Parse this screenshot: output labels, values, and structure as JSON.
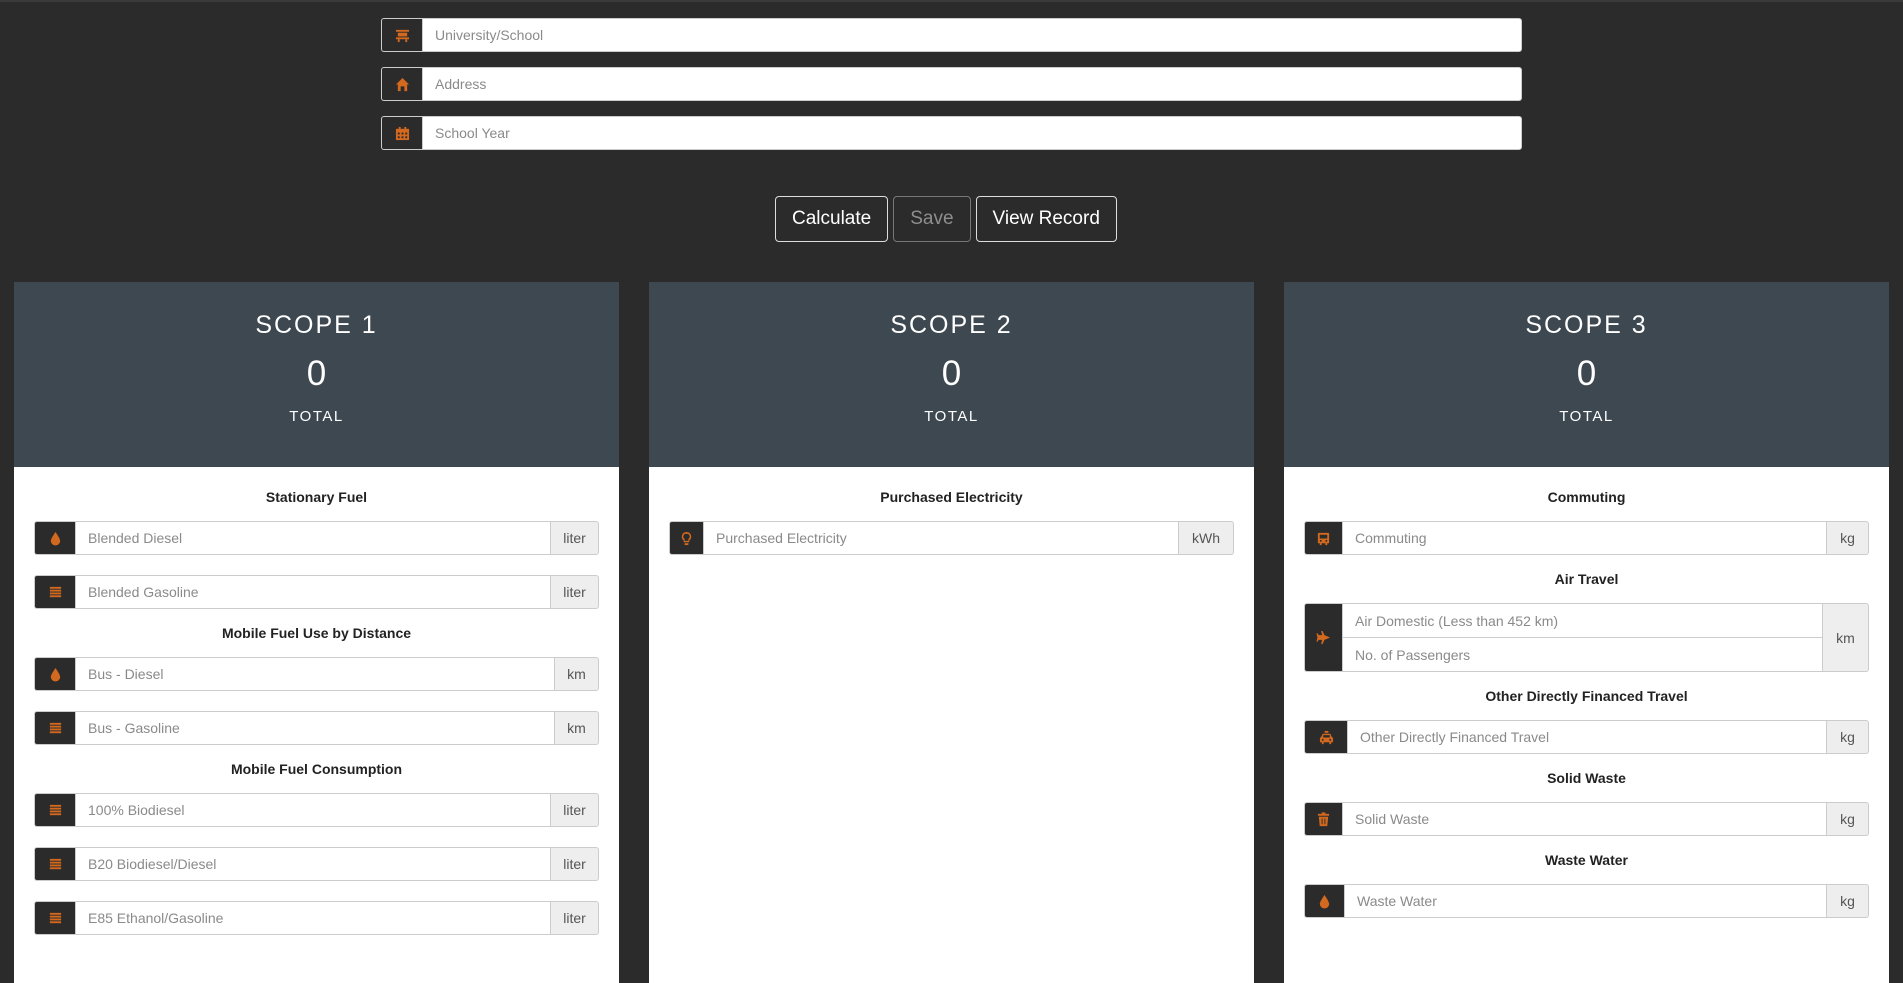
{
  "top_form": {
    "university_placeholder": "University/School",
    "address_placeholder": "Address",
    "school_year_placeholder": "School Year",
    "icons": [
      "school-icon",
      "home-icon",
      "calendar-icon"
    ]
  },
  "actions": {
    "calculate": "Calculate",
    "save": "Save",
    "view_record": "View Record"
  },
  "accent_color": "#d2691e",
  "scope1": {
    "title": "SCOPE 1",
    "total": "0",
    "total_label": "TOTAL",
    "stationary_title": "Stationary Fuel",
    "blended_diesel": "Blended Diesel",
    "blended_gasoline": "Blended Gasoline",
    "mobile_distance_title": "Mobile Fuel Use by Distance",
    "bus_diesel": "Bus - Diesel",
    "bus_gasoline": "Bus - Gasoline",
    "mobile_consumption_title": "Mobile Fuel Consumption",
    "biodiesel_100": "100% Biodiesel",
    "b20": "B20 Biodiesel/Diesel",
    "e85": "E85 Ethanol/Gasoline",
    "unit_liter": "liter",
    "unit_km": "km"
  },
  "scope2": {
    "title": "SCOPE 2",
    "total": "0",
    "total_label": "TOTAL",
    "electricity_title": "Purchased Electricity",
    "electricity_placeholder": "Purchased Electricity",
    "unit_kwh": "kWh"
  },
  "scope3": {
    "title": "SCOPE 3",
    "total": "0",
    "total_label": "TOTAL",
    "commuting_title": "Commuting",
    "commuting_placeholder": "Commuting",
    "air_title": "Air Travel",
    "air_domestic_placeholder": "Air Domestic (Less than 452 km)",
    "passengers_placeholder": "No. of Passengers",
    "other_travel_title": "Other Directly Financed Travel",
    "other_travel_placeholder": "Other Directly Financed Travel",
    "solid_waste_title": "Solid Waste",
    "solid_waste_placeholder": "Solid Waste",
    "waste_water_title": "Waste Water",
    "waste_water_placeholder": "Waste Water",
    "unit_kg": "kg",
    "unit_km": "km"
  }
}
